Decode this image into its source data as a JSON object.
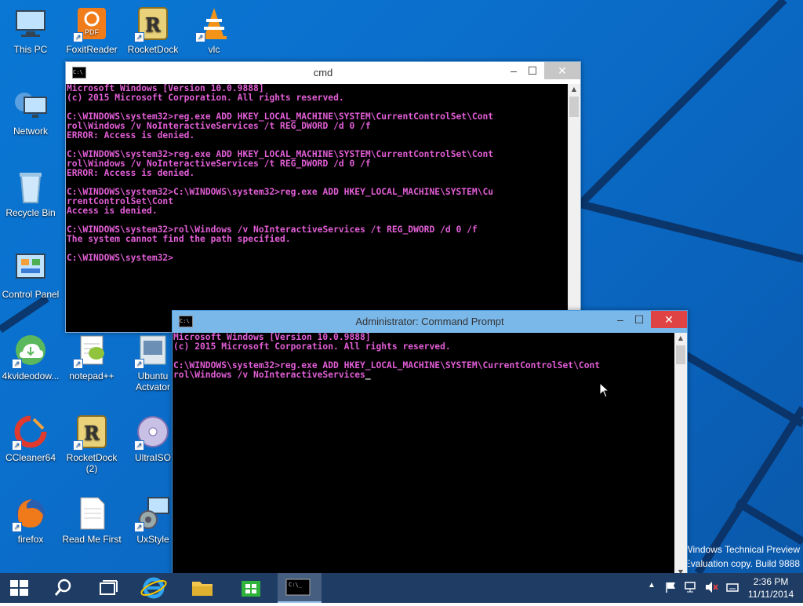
{
  "desktop": {
    "icons": [
      {
        "label": "This PC",
        "icon": "this-pc-icon"
      },
      {
        "label": "FoxitReader",
        "icon": "foxit-reader-icon"
      },
      {
        "label": "RocketDock",
        "icon": "rocketdock-icon"
      },
      {
        "label": "vlc",
        "icon": "vlc-icon"
      },
      {
        "label": "Network",
        "icon": "network-icon"
      },
      {
        "label": "Recycle Bin",
        "icon": "recycle-bin-icon"
      },
      {
        "label": "Control Panel",
        "icon": "control-panel-icon"
      },
      {
        "label": "4kvideodow...",
        "icon": "4kvideodownloader-icon"
      },
      {
        "label": "notepad++",
        "icon": "notepad-plus-plus-icon"
      },
      {
        "label": "Ubuntu Actvator",
        "icon": "ubuntu-activator-icon"
      },
      {
        "label": "CCleaner64",
        "icon": "ccleaner-icon"
      },
      {
        "label": "RocketDock (2)",
        "icon": "rocketdock-icon"
      },
      {
        "label": "UltraISO",
        "icon": "ultraiso-icon"
      },
      {
        "label": "firefox",
        "icon": "firefox-icon"
      },
      {
        "label": "Read Me First",
        "icon": "document-icon"
      },
      {
        "label": "UxStyle",
        "icon": "uxstyle-icon"
      }
    ],
    "watermark": {
      "line1": "Windows Technical Preview",
      "line2": "Evaluation copy. Build 9888"
    }
  },
  "cmd_window": {
    "title": "cmd",
    "lines": [
      "Microsoft Windows [Version 10.0.9888]",
      "(c) 2015 Microsoft Corporation. All rights reserved.",
      "",
      "C:\\WINDOWS\\system32>reg.exe ADD HKEY_LOCAL_MACHINE\\SYSTEM\\CurrentControlSet\\Cont",
      "rol\\Windows /v NoInteractiveServices /t REG_DWORD /d 0 /f",
      "ERROR: Access is denied.",
      "",
      "C:\\WINDOWS\\system32>reg.exe ADD HKEY_LOCAL_MACHINE\\SYSTEM\\CurrentControlSet\\Cont",
      "rol\\Windows /v NoInteractiveServices /t REG_DWORD /d 0 /f",
      "ERROR: Access is denied.",
      "",
      "C:\\WINDOWS\\system32>C:\\WINDOWS\\system32>reg.exe ADD HKEY_LOCAL_MACHINE\\SYSTEM\\Cu",
      "rrentControlSet\\Cont",
      "Access is denied.",
      "",
      "C:\\WINDOWS\\system32>rol\\Windows /v NoInteractiveServices /t REG_DWORD /d 0 /f",
      "The system cannot find the path specified.",
      "",
      "C:\\WINDOWS\\system32>"
    ]
  },
  "admin_window": {
    "title": "Administrator: Command Prompt",
    "lines": [
      "Microsoft Windows [Version 10.0.9888]",
      "(c) 2015 Microsoft Corporation. All rights reserved.",
      "",
      "C:\\WINDOWS\\system32>reg.exe ADD HKEY_LOCAL_MACHINE\\SYSTEM\\CurrentControlSet\\Cont",
      "rol\\Windows /v NoInteractiveServices"
    ],
    "cursor": "_"
  },
  "taskbar": {
    "items": [
      {
        "name": "start-button",
        "icon": "windows-logo-icon"
      },
      {
        "name": "search-button",
        "icon": "search-icon"
      },
      {
        "name": "task-view-button",
        "icon": "task-view-icon"
      },
      {
        "name": "internet-explorer-button",
        "icon": "internet-explorer-icon"
      },
      {
        "name": "file-explorer-button",
        "icon": "folder-icon"
      },
      {
        "name": "store-button",
        "icon": "store-icon"
      },
      {
        "name": "command-prompt-button",
        "icon": "command-prompt-icon"
      }
    ],
    "clock": {
      "time": "2:36 PM",
      "date": "11/11/2014"
    }
  },
  "colors": {
    "console_text": "#e25ed6",
    "taskbar": "#1e3c64",
    "desktop": "#0a6ecb"
  }
}
